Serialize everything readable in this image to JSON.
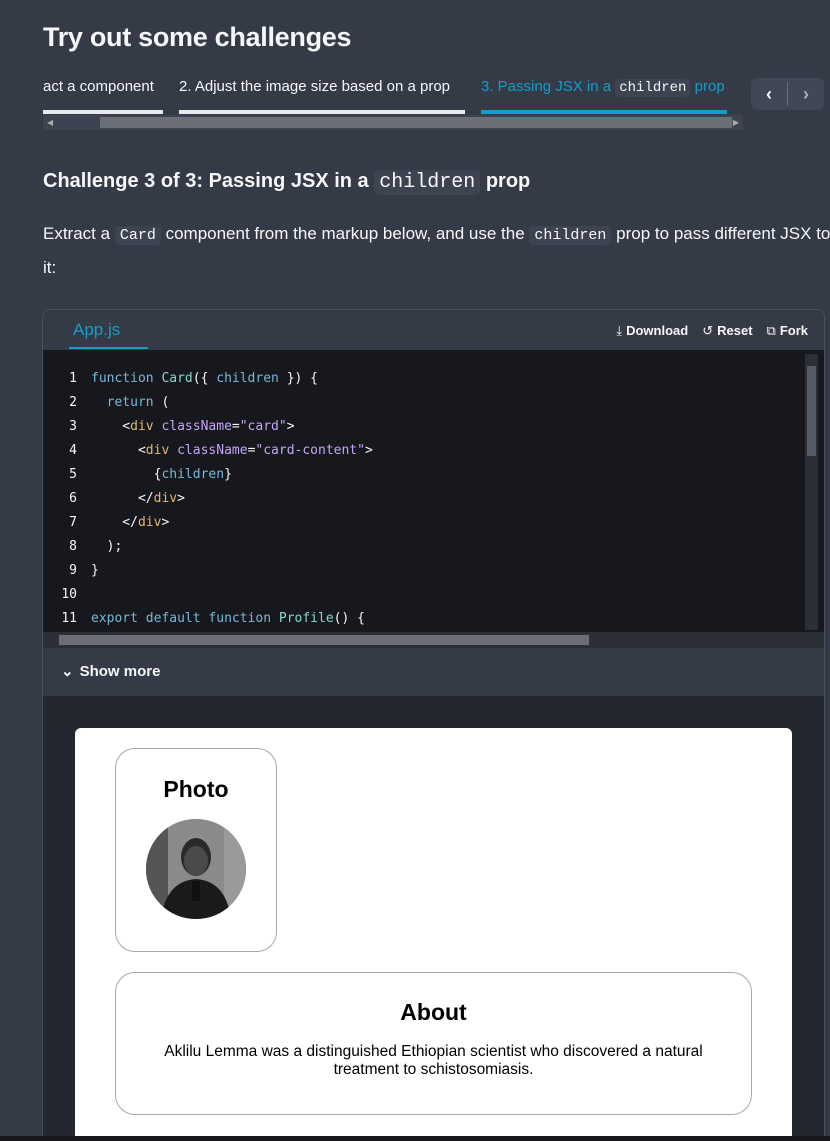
{
  "section": {
    "title": "Try out some challenges"
  },
  "tabs": [
    {
      "label": "act a component",
      "active": false
    },
    {
      "label": "2. Adjust the image size based on a prop",
      "active": false
    },
    {
      "label_prefix": "3. Passing JSX in a",
      "label_code": "children",
      "label_suffix": "prop",
      "active": true
    }
  ],
  "challenge": {
    "heading_bold": "Challenge 3 of 3:",
    "heading_text": "Passing JSX in a",
    "heading_code": "children",
    "heading_suffix": "prop",
    "desc_1": "Extract a",
    "desc_code_1": "Card",
    "desc_2": "component from the markup below, and use the",
    "desc_code_2": "children",
    "desc_3": "prop to pass different JSX to it:"
  },
  "sandbox": {
    "file_name": "App.js",
    "actions": {
      "download": "Download",
      "reset": "Reset",
      "fork": "Fork"
    },
    "show_more": "Show more",
    "code_lines": [
      {
        "n": "1",
        "text": "function Card({ children }) {"
      },
      {
        "n": "2",
        "text": "  return ("
      },
      {
        "n": "3",
        "text": "    <div className=\"card\">"
      },
      {
        "n": "4",
        "text": "      <div className=\"card-content\">"
      },
      {
        "n": "5",
        "text": "        {children}"
      },
      {
        "n": "6",
        "text": "      </div>"
      },
      {
        "n": "7",
        "text": "    </div>"
      },
      {
        "n": "8",
        "text": "  );"
      },
      {
        "n": "9",
        "text": "}"
      },
      {
        "n": "10",
        "text": ""
      },
      {
        "n": "11",
        "text": "export default function Profile() {"
      }
    ]
  },
  "preview": {
    "photo_title": "Photo",
    "about_title": "About",
    "about_text": "Aklilu Lemma was a distinguished Ethiopian scientist who discovered a natural treatment to schistosomiasis."
  },
  "colors": {
    "accent": "#149eca",
    "panel_bg": "#343a46",
    "editor_bg": "#16181d"
  }
}
